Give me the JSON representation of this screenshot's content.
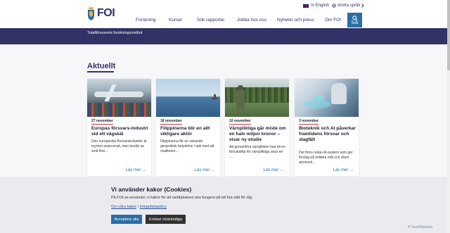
{
  "header": {
    "logo_text": "FOI",
    "nav": [
      "Forskning",
      "Kurser",
      "Sök rapporter",
      "Jobba hos oss",
      "Nyheter och press",
      "Om FOI"
    ],
    "lang_english": "In English",
    "other_languages": "Andra språk",
    "search_label": "Sök"
  },
  "banner": {
    "text": "Totalförsvarets forskningsinstitut"
  },
  "main": {
    "section_title": "Aktuellt",
    "read_more": "Läs mer",
    "cards": [
      {
        "date": "27 november",
        "title": "Europas försvars-industri vid ett vägskäl",
        "text": "Den europeiska försvarsindustrin är mycket avancerad, men består av små före…"
      },
      {
        "date": "18 november",
        "title": "Filippinerna blir en allt viktigare aktör",
        "text": "Filippinerna får en växande geopolitisk betydelse i takt med att rivaliteten…"
      },
      {
        "date": "10 november",
        "title": "Värnpliktiga går miste om en halv miljon kronor – visar ny studie",
        "text": "Att genomföra värnplikten kan bli en förlustaffär för värnpliktiga visar en …"
      },
      {
        "date": "3 november",
        "title": "Bioteknik och AI påverkar framtidens försvar och slagfält",
        "text": "Det finns redan AI-system som ger förslag på militära mål och viken ammunit…"
      }
    ]
  },
  "cookie": {
    "title": "Vi använder kakor (Cookies)",
    "text": "På FOI.se använder vi kakor för att webbplatsen ska fungera på ett bra sätt för dig.",
    "link1": "Om våra kakor",
    "link2": "Integritetspolicy",
    "accept": "Acceptera alla",
    "necessary": "Endast nödvändiga"
  },
  "watermark": "ScanMalware",
  "colors": {
    "brand": "#323266",
    "accent": "#2b6ea6",
    "date_underline": "#c0394a"
  }
}
